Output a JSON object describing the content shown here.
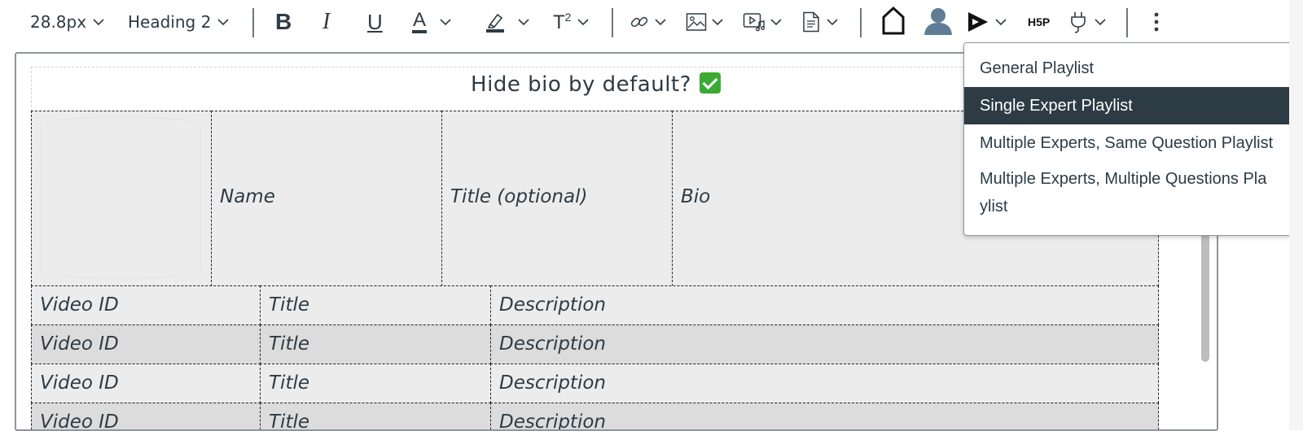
{
  "toolbar": {
    "font_size": "28.8px",
    "block_format": "Heading 2",
    "icons": {
      "bold": "B",
      "italic": "I",
      "underline": "U",
      "text_color": "A",
      "superscript": "T",
      "superscript_mark": "2",
      "h5p": "H5P"
    }
  },
  "editor": {
    "heading": "Hide bio by default?",
    "profile_row": {
      "name": "Name",
      "title": "Title (optional)",
      "bio": "Bio"
    },
    "video_rows": [
      {
        "id": "Video ID",
        "title": "Title",
        "description": "Description"
      },
      {
        "id": "Video ID",
        "title": "Title",
        "description": "Description"
      },
      {
        "id": "Video ID",
        "title": "Title",
        "description": "Description"
      },
      {
        "id": "Video ID",
        "title": "Title",
        "description": "Description"
      }
    ]
  },
  "menu": {
    "items": [
      "General Playlist",
      "Single Expert Playlist",
      "Multiple Experts, Same Question Playlist",
      "Multiple Experts, Multiple Questions Pla"
    ],
    "item4_wrap": "ylist",
    "selected": "Single Expert Playlist"
  },
  "colors": {
    "text": "#2d3b45",
    "selected_bg": "#2d3b45",
    "check": "#3aaa35"
  }
}
